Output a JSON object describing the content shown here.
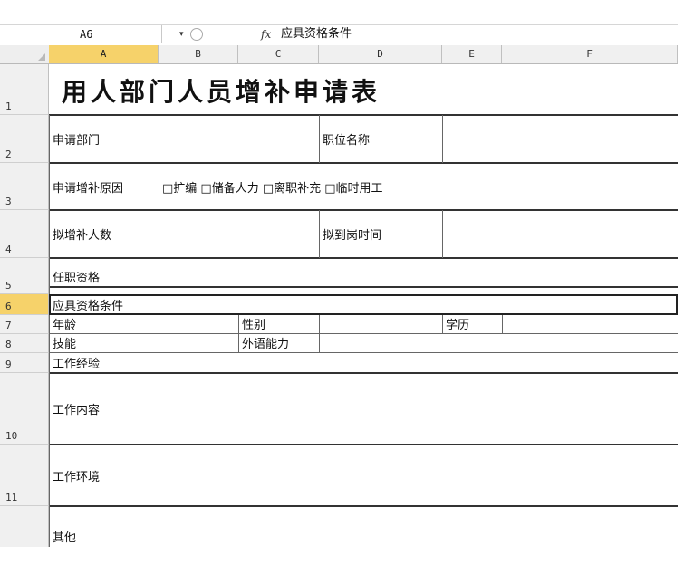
{
  "formula_bar": {
    "name_box": "A6",
    "dropdown": "▾",
    "fx": "fx",
    "content": "应具资格条件"
  },
  "columns": [
    "A",
    "B",
    "C",
    "D",
    "E",
    "F"
  ],
  "rows": [
    "1",
    "2",
    "3",
    "4",
    "5",
    "6",
    "7",
    "8",
    "9",
    "10",
    "11"
  ],
  "sheet": {
    "title": "用人部门人员增补申请表",
    "r2": {
      "a": "申请部门",
      "d": "职位名称"
    },
    "r3": {
      "a": "申请增补原因",
      "options": "□扩编  □储备人力  □离职补充  □临时用工"
    },
    "r4": {
      "a": "拟增补人数",
      "d": "拟到岗时间"
    },
    "r5": {
      "a": "任职资格"
    },
    "r6": {
      "a": "应具资格条件"
    },
    "r7": {
      "a": "年龄",
      "c": "性别",
      "e": "学历"
    },
    "r8": {
      "a": "技能",
      "c": "外语能力"
    },
    "r9": {
      "a": "工作经验"
    },
    "r10": {
      "a": "工作内容"
    },
    "r11": {
      "a": "工作环境"
    },
    "r12": {
      "a": "其他"
    }
  }
}
